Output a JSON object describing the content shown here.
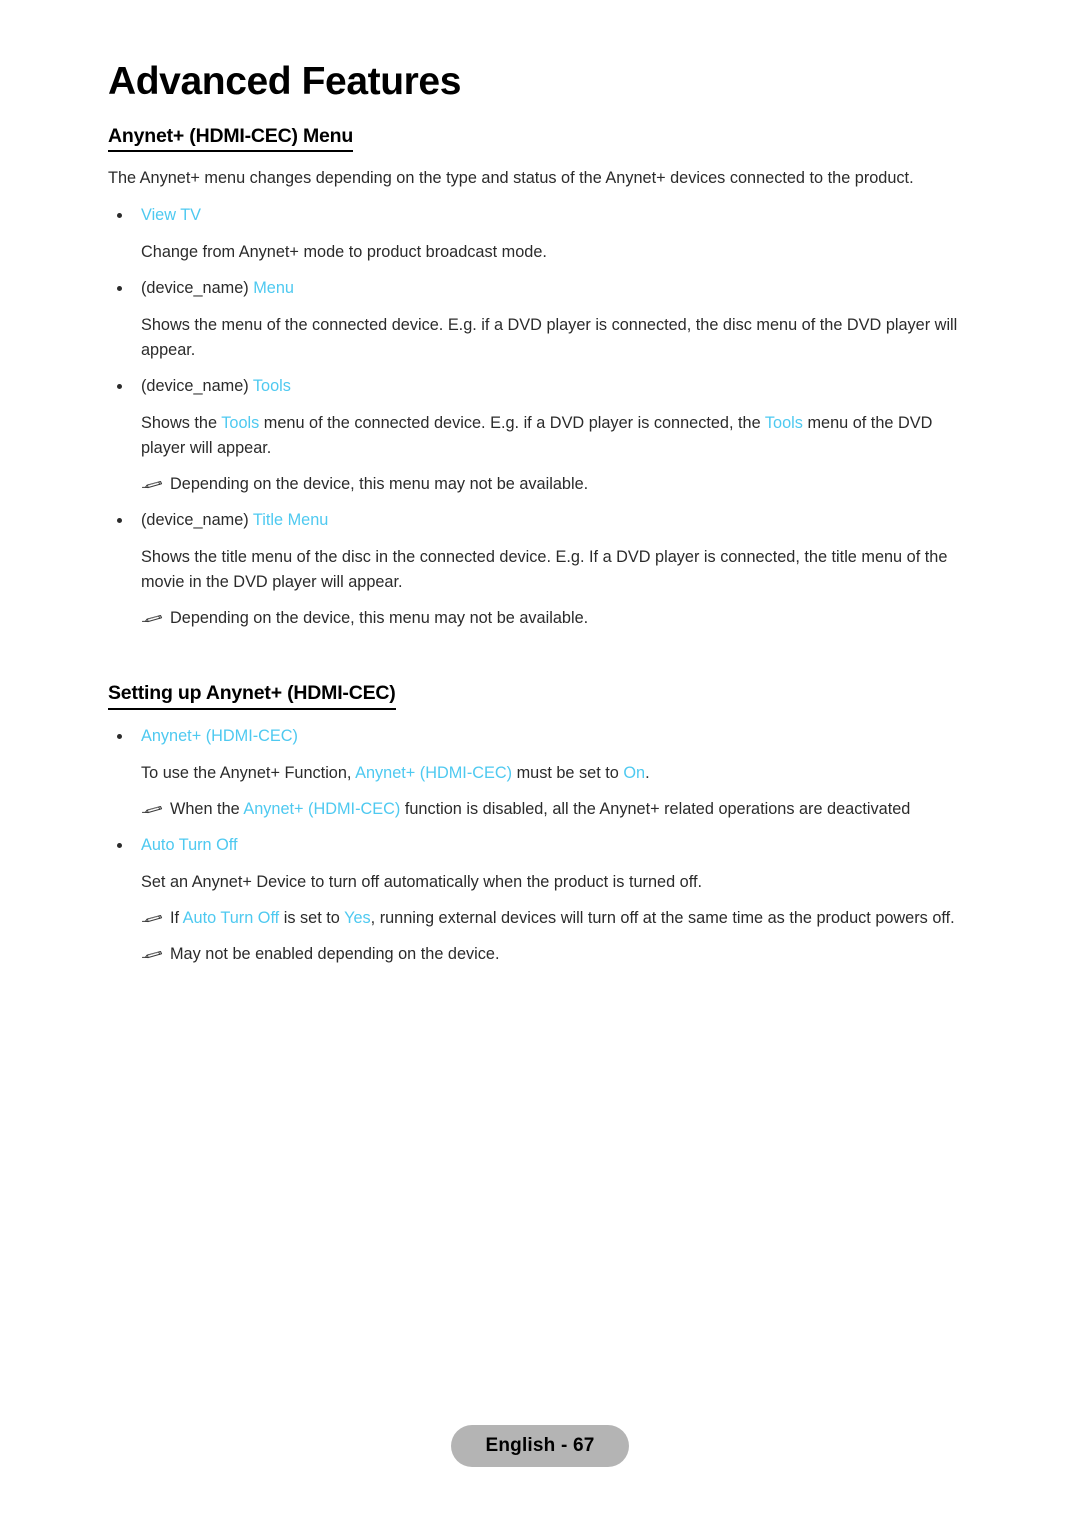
{
  "document": {
    "chapter_title": "Advanced Features",
    "footer_label": "English - 67",
    "accent_color": "#4ec9f0",
    "text_color": "#2b2b2b",
    "pill_color": "#b4b4b4"
  },
  "section1": {
    "heading": "Anynet+ (HDMI-CEC) Menu",
    "intro": "The Anynet+ menu changes depending on the type and status of the Anynet+ devices connected to the product.",
    "items": [
      {
        "bullet_plain": "",
        "bullet_ui": "View TV",
        "body": "Change from Anynet+ mode to product broadcast mode.",
        "notes": []
      },
      {
        "bullet_plain": "(device_name) ",
        "bullet_ui": "Menu",
        "body_a": "Shows the menu of the connected device. E.g. if a DVD player is connected, the disc menu of the DVD player will appear.",
        "notes": []
      },
      {
        "bullet_plain": "(device_name) ",
        "bullet_ui": "Tools",
        "body_pre": "Shows the ",
        "body_ui1": "Tools",
        "body_mid": " menu of the connected device. E.g. if a DVD player is connected, the ",
        "body_ui2": "Tools",
        "body_post": " menu of the DVD player will appear.",
        "note1": "Depending on the device, this menu may not be available."
      },
      {
        "bullet_plain": "(device_name) ",
        "bullet_ui": "Title Menu",
        "body": "Shows the title menu of the disc in the connected device. E.g. If a DVD player is connected, the title menu of the movie in the DVD player will appear.",
        "note1": "Depending on the device, this menu may not be available."
      }
    ]
  },
  "section2": {
    "heading": "Setting up Anynet+ (HDMI-CEC)",
    "item1": {
      "bullet_ui": "Anynet+ (HDMI-CEC)",
      "body_pre": "To use the Anynet+ Function, ",
      "body_ui1": "Anynet+ (HDMI-CEC)",
      "body_mid": " must be set to ",
      "body_ui2": "On",
      "body_post": ".",
      "note_pre": "When the ",
      "note_ui": "Anynet+ (HDMI-CEC)",
      "note_post": " function is disabled, all the Anynet+ related operations are deactivated"
    },
    "item2": {
      "bullet_ui": "Auto Turn Off",
      "body": "Set an Anynet+ Device to turn off automatically when the product is turned off.",
      "note1_pre": "If ",
      "note1_ui1": "Auto Turn Off",
      "note1_mid": " is set to ",
      "note1_ui2": "Yes",
      "note1_post": ", running external devices will turn off at the same time as the product powers off.",
      "note2": "May not be enabled depending on the device."
    }
  }
}
